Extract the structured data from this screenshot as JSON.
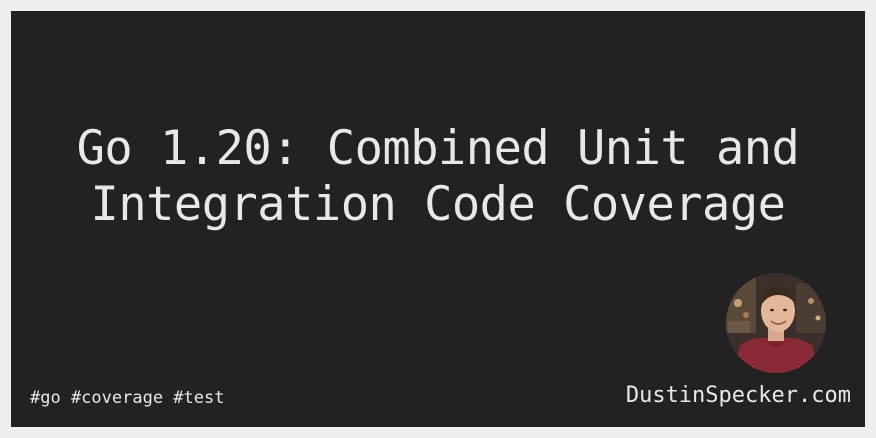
{
  "title": {
    "line1": "Go 1.20: Combined Unit and",
    "line2": "Integration Code Coverage"
  },
  "tags": "#go #coverage #test",
  "site": "DustinSpecker.com",
  "colors": {
    "background": "#222222",
    "frame": "#efefef",
    "text": "#e8e8e8"
  },
  "avatar_icon": "author-portrait"
}
